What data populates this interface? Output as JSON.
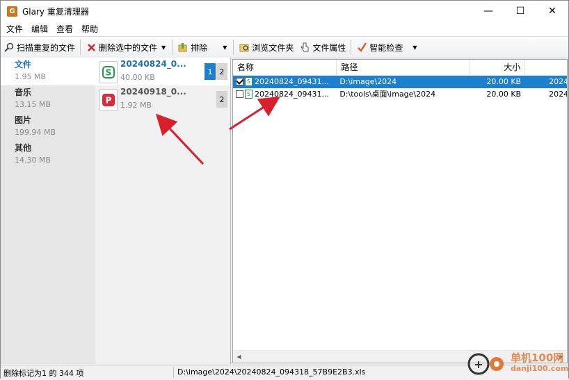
{
  "window": {
    "title": "Glary 重复清理器",
    "controls": {
      "minimize": "—",
      "maximize": "☐",
      "close": "✕"
    }
  },
  "menu": [
    "文件",
    "编辑",
    "查看",
    "帮助"
  ],
  "toolbar": {
    "scan_label": "扫描重复的文件",
    "delete_label": "删除选中的文件",
    "sort_label": "排除",
    "browse_label": "浏览文件夹",
    "properties_label": "文件属性",
    "smart_check_label": "智能检查",
    "dropdown_glyph": "▼"
  },
  "categories": [
    {
      "name": "文件",
      "size": "1.95 MB",
      "active": true
    },
    {
      "name": "音乐",
      "size": "13.15 MB",
      "active": false
    },
    {
      "name": "图片",
      "size": "199.94 MB",
      "active": false
    },
    {
      "name": "其他",
      "size": "14.30 MB",
      "active": false
    }
  ],
  "groups": [
    {
      "name": "20240824_0...",
      "size": "40.00 KB",
      "icon": "spreadsheet-icon",
      "icon_letter": "S",
      "icon_color": "#1f9a4a",
      "selected_count": "1",
      "total_count": "2",
      "active": true
    },
    {
      "name": "20240918_0...",
      "size": "1.92 MB",
      "icon": "pdf-icon",
      "icon_letter": "P",
      "icon_color": "#e0283a",
      "selected_count": "",
      "total_count": "2",
      "active": false
    }
  ],
  "detail": {
    "columns": {
      "name": "名称",
      "path": "路径",
      "size": "大小",
      "date": ""
    },
    "rows": [
      {
        "checked": true,
        "name": "20240824_09431...",
        "path": "D:\\image\\2024",
        "size": "20.00 KB",
        "date": "2024",
        "selected": true
      },
      {
        "checked": false,
        "name": "20240824_09431...",
        "path": "D:\\tools\\桌面\\image\\2024",
        "size": "20.00 KB",
        "date": "2024",
        "selected": false
      }
    ],
    "icon_letter": "S"
  },
  "scrollbar": {
    "left": "◀",
    "right": "▶"
  },
  "status": {
    "marked": "删除标记为1 的 344 项",
    "path": "D:\\image\\2024\\20240824_094318_57B9E2B3.xls"
  },
  "watermark": {
    "text": "单机100网",
    "sub": "danji100.com"
  },
  "colors": {
    "accent": "#1f7fcf",
    "arrow": "#d8202a",
    "category_active": "#1f6fb5"
  }
}
